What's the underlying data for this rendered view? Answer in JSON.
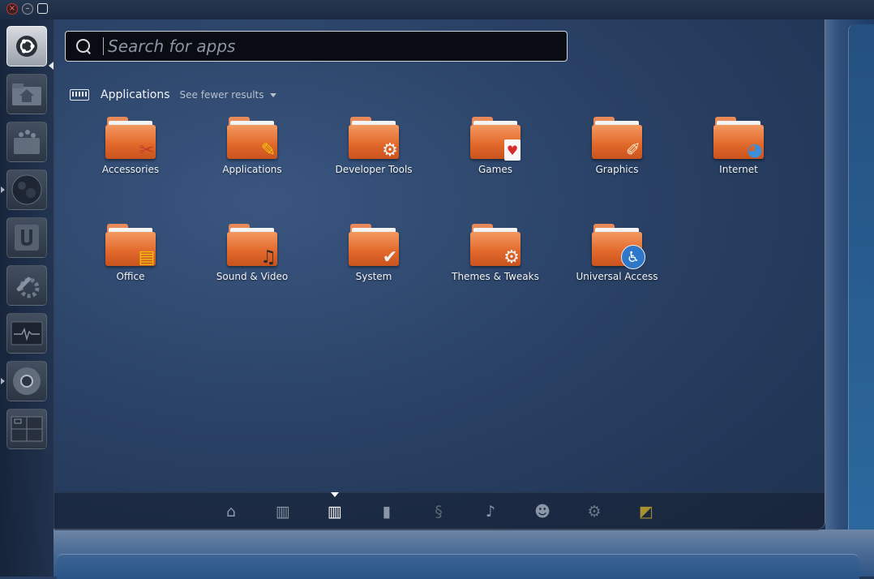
{
  "window_controls": {
    "close_glyph": "×",
    "minimize_glyph": "–",
    "maximize_glyph": "□"
  },
  "launcher": {
    "items": [
      {
        "name": "dash-home-button",
        "icon": "ubuntu-logo-icon",
        "glyph": "◉"
      },
      {
        "name": "home-folder",
        "icon": "home-folder-icon",
        "glyph": "⌂"
      },
      {
        "name": "software-center",
        "icon": "software-center-icon",
        "glyph": "✦"
      },
      {
        "name": "browser",
        "icon": "globe-icon",
        "glyph": "●"
      },
      {
        "name": "ubuntu-one",
        "icon": "ubuntu-one-icon",
        "glyph": "U"
      },
      {
        "name": "system-settings",
        "icon": "wrench-gear-icon",
        "glyph": "⚙"
      },
      {
        "name": "system-monitor",
        "icon": "system-monitor-icon",
        "glyph": "∿"
      },
      {
        "name": "chromium",
        "icon": "chromium-icon",
        "glyph": "◍"
      },
      {
        "name": "workspace-switcher",
        "icon": "workspace-switcher-icon",
        "glyph": "▦"
      }
    ]
  },
  "search": {
    "placeholder": "Search for apps",
    "value": ""
  },
  "category": {
    "title": "Applications",
    "toggle_label": "See fewer results"
  },
  "apps": [
    {
      "label": "Accessories",
      "emblem": "✂"
    },
    {
      "label": "Applications",
      "emblem": "✎"
    },
    {
      "label": "Developer Tools",
      "emblem": "⚙"
    },
    {
      "label": "Games",
      "emblem": "♥"
    },
    {
      "label": "Graphics",
      "emblem": "✐"
    },
    {
      "label": "Internet",
      "emblem": "◕"
    },
    {
      "label": "Office",
      "emblem": "▤"
    },
    {
      "label": "Sound & Video",
      "emblem": "♫"
    },
    {
      "label": "System",
      "emblem": "✔"
    },
    {
      "label": "Themes & Tweaks",
      "emblem": "⚙"
    },
    {
      "label": "Universal Access",
      "emblem": "♿"
    }
  ],
  "lenses": [
    {
      "name": "home",
      "icon": "home-icon",
      "glyph": "⌂",
      "active": false
    },
    {
      "name": "applications",
      "icon": "applications-icon",
      "glyph": "▥",
      "active": false
    },
    {
      "name": "applications-active",
      "icon": "applications-icon",
      "glyph": "▥",
      "active": true
    },
    {
      "name": "files",
      "icon": "file-icon",
      "glyph": "▮",
      "active": false
    },
    {
      "name": "python",
      "icon": "python-icon",
      "glyph": "§",
      "active": false
    },
    {
      "name": "music",
      "icon": "music-note-icon",
      "glyph": "♪",
      "active": false
    },
    {
      "name": "reddit",
      "icon": "reddit-icon",
      "glyph": "☻",
      "active": false
    },
    {
      "name": "settings",
      "icon": "gears-icon",
      "glyph": "⚙",
      "active": false
    },
    {
      "name": "photos",
      "icon": "photo-icon",
      "glyph": "◩",
      "active": false
    }
  ],
  "colors": {
    "folder_orange": "#e36a2c",
    "lens_inactive": "#8a95a6",
    "lens_active": "#ffffff"
  }
}
